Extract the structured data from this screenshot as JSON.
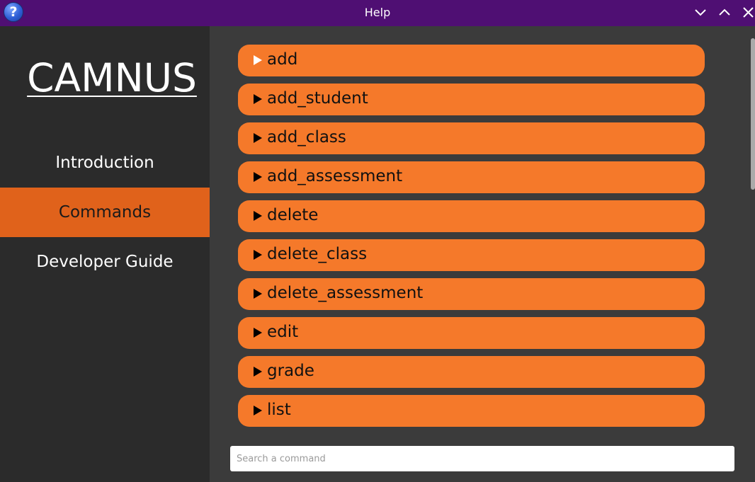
{
  "window": {
    "title": "Help",
    "app_icon": "help-icon",
    "app_icon_glyph": "?",
    "controls": [
      "chevron-down-icon",
      "chevron-up-icon",
      "close-icon"
    ]
  },
  "sidebar": {
    "logo": "CAMNUS",
    "items": [
      {
        "label": "Introduction",
        "active": false
      },
      {
        "label": "Commands",
        "active": true
      },
      {
        "label": "Developer Guide",
        "active": false
      }
    ]
  },
  "commands": [
    {
      "label": "add",
      "arrow_color": "#ffffff"
    },
    {
      "label": "add_student",
      "arrow_color": "#000000"
    },
    {
      "label": "add_class",
      "arrow_color": "#000000"
    },
    {
      "label": "add_assessment",
      "arrow_color": "#000000"
    },
    {
      "label": "delete",
      "arrow_color": "#000000"
    },
    {
      "label": "delete_class",
      "arrow_color": "#000000"
    },
    {
      "label": "delete_assessment",
      "arrow_color": "#000000"
    },
    {
      "label": "edit",
      "arrow_color": "#000000"
    },
    {
      "label": "grade",
      "arrow_color": "#000000"
    },
    {
      "label": "list",
      "arrow_color": "#000000"
    }
  ],
  "search": {
    "placeholder": "Search a command",
    "value": ""
  },
  "colors": {
    "titlebar": "#4f0f73",
    "sidebar": "#2b2b2b",
    "main": "#3b3b3b",
    "accent": "#f5792a",
    "active_nav": "#e0621b"
  }
}
